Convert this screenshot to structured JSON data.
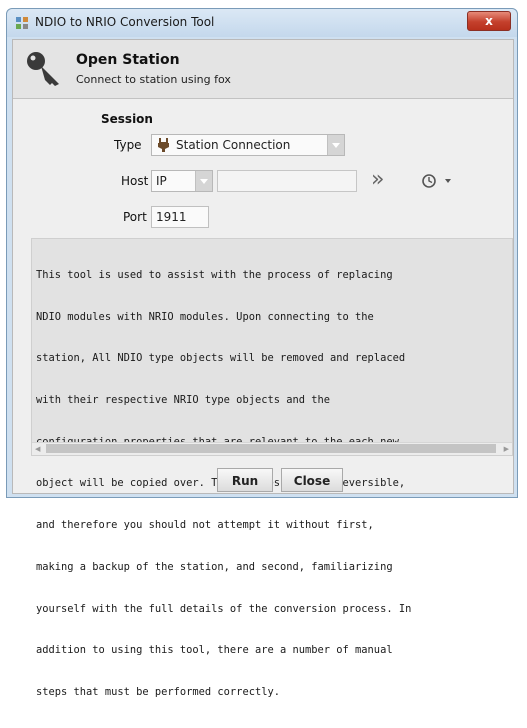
{
  "window": {
    "title": "NDIO to NRIO Conversion Tool",
    "close_glyph": "x"
  },
  "header": {
    "title": "Open Station",
    "subtitle": "Connect to station using fox"
  },
  "session": {
    "label": "Session",
    "type_label": "Type",
    "type_value": "Station Connection",
    "host_label": "Host",
    "host_protocol": "IP",
    "host_address": "",
    "port_label": "Port",
    "port_value": "1911"
  },
  "description_lines": [
    "This tool is used to assist with the process of replacing",
    "NDIO modules with NRIO modules. Upon connecting to the",
    "station, All NDIO type objects will be removed and replaced",
    "with their respective NRIO type objects and the",
    "configuration properties that are relevant to the each new",
    "object will be copied over. This process is not reversible,",
    "and therefore you should not attempt it without first,",
    "making a backup of the station, and second, familiarizing",
    "yourself with the full details of the conversion process. In",
    "addition to using this tool, there are a number of manual",
    "steps that must be performed correctly."
  ],
  "buttons": {
    "run": "Run",
    "close": "Close"
  },
  "icons": {
    "app": "app-icon",
    "key": "key-icon",
    "plug": "station-plug-icon",
    "go": "go-double-chevron-icon",
    "history": "history-clock-icon"
  }
}
